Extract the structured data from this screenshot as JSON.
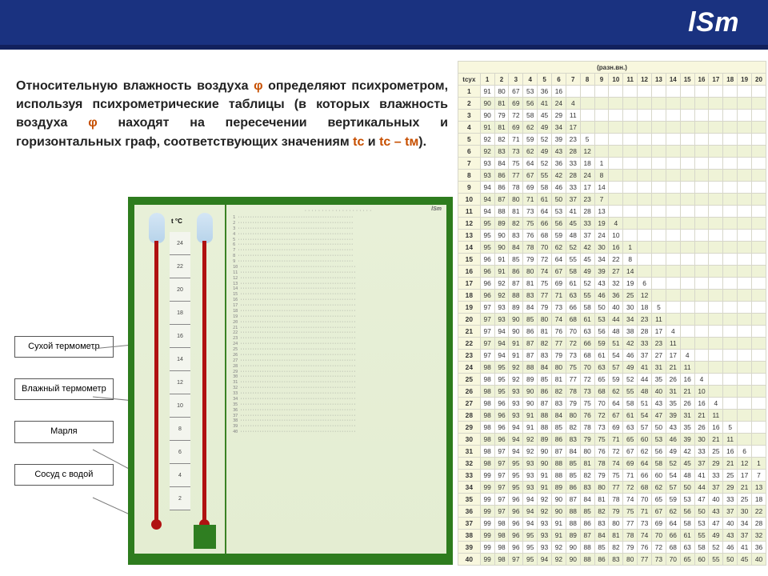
{
  "brand": "lSm",
  "desc": {
    "a": "Относительную влажность воздуха ",
    "phi": "φ",
    "b": " определяют психрометром, используя психрометрические таблицы (в которых влажность воздуха ",
    "c": " находят на пересечении вертикальных и горизонтальных граф, соответствующих значениям ",
    "tc": "tс",
    "and": " и ",
    "diff": "tс – tм",
    "end": ")."
  },
  "labels": {
    "dry": "Сухой термометр",
    "wet": "Влажный термометр",
    "gauze": "Марля",
    "vessel": "Сосуд с водой"
  },
  "scale": {
    "title": "t °C",
    "ticks": [
      "24",
      "22",
      "20",
      "18",
      "16",
      "14",
      "12",
      "10",
      "8",
      "6",
      "4",
      "2"
    ]
  },
  "table": {
    "unit_header": "(разн.вн.)",
    "lead": "tсух",
    "cols": [
      "1",
      "2",
      "3",
      "4",
      "5",
      "6",
      "7",
      "8",
      "9",
      "10",
      "11",
      "12",
      "13",
      "14",
      "15",
      "16",
      "17",
      "18",
      "19",
      "20"
    ],
    "rows": [
      {
        "t": "1",
        "v": [
          "91",
          "80",
          "67",
          "53",
          "36",
          "16",
          "",
          "",
          "",
          "",
          "",
          "",
          "",
          "",
          "",
          "",
          "",
          "",
          "",
          ""
        ]
      },
      {
        "t": "2",
        "v": [
          "90",
          "81",
          "69",
          "56",
          "41",
          "24",
          "4",
          "",
          "",
          "",
          "",
          "",
          "",
          "",
          "",
          "",
          "",
          "",
          "",
          ""
        ]
      },
      {
        "t": "3",
        "v": [
          "90",
          "79",
          "72",
          "58",
          "45",
          "29",
          "11",
          "",
          "",
          "",
          "",
          "",
          "",
          "",
          "",
          "",
          "",
          "",
          "",
          ""
        ]
      },
      {
        "t": "4",
        "v": [
          "91",
          "81",
          "69",
          "62",
          "49",
          "34",
          "17",
          "",
          "",
          "",
          "",
          "",
          "",
          "",
          "",
          "",
          "",
          "",
          "",
          ""
        ]
      },
      {
        "t": "5",
        "v": [
          "92",
          "82",
          "71",
          "59",
          "52",
          "39",
          "23",
          "5",
          "",
          "",
          "",
          "",
          "",
          "",
          "",
          "",
          "",
          "",
          "",
          ""
        ]
      },
      {
        "t": "6",
        "v": [
          "92",
          "83",
          "73",
          "62",
          "49",
          "43",
          "28",
          "12",
          "",
          "",
          "",
          "",
          "",
          "",
          "",
          "",
          "",
          "",
          "",
          ""
        ]
      },
      {
        "t": "7",
        "v": [
          "93",
          "84",
          "75",
          "64",
          "52",
          "36",
          "33",
          "18",
          "1",
          "",
          "",
          "",
          "",
          "",
          "",
          "",
          "",
          "",
          "",
          ""
        ]
      },
      {
        "t": "8",
        "v": [
          "93",
          "86",
          "77",
          "67",
          "55",
          "42",
          "28",
          "24",
          "8",
          "",
          "",
          "",
          "",
          "",
          "",
          "",
          "",
          "",
          "",
          ""
        ]
      },
      {
        "t": "9",
        "v": [
          "94",
          "86",
          "78",
          "69",
          "58",
          "46",
          "33",
          "17",
          "14",
          "",
          "",
          "",
          "",
          "",
          "",
          "",
          "",
          "",
          "",
          ""
        ]
      },
      {
        "t": "10",
        "v": [
          "94",
          "87",
          "80",
          "71",
          "61",
          "50",
          "37",
          "23",
          "7",
          "",
          "",
          "",
          "",
          "",
          "",
          "",
          "",
          "",
          "",
          ""
        ]
      },
      {
        "t": "11",
        "v": [
          "94",
          "88",
          "81",
          "73",
          "64",
          "53",
          "41",
          "28",
          "13",
          "",
          "",
          "",
          "",
          "",
          "",
          "",
          "",
          "",
          "",
          ""
        ]
      },
      {
        "t": "12",
        "v": [
          "95",
          "89",
          "82",
          "75",
          "66",
          "56",
          "45",
          "33",
          "19",
          "4",
          "",
          "",
          "",
          "",
          "",
          "",
          "",
          "",
          "",
          ""
        ]
      },
      {
        "t": "13",
        "v": [
          "95",
          "90",
          "83",
          "76",
          "68",
          "59",
          "48",
          "37",
          "24",
          "10",
          "",
          "",
          "",
          "",
          "",
          "",
          "",
          "",
          "",
          ""
        ]
      },
      {
        "t": "14",
        "v": [
          "95",
          "90",
          "84",
          "78",
          "70",
          "62",
          "52",
          "42",
          "30",
          "16",
          "1",
          "",
          "",
          "",
          "",
          "",
          "",
          "",
          "",
          ""
        ]
      },
      {
        "t": "15",
        "v": [
          "96",
          "91",
          "85",
          "79",
          "72",
          "64",
          "55",
          "45",
          "34",
          "22",
          "8",
          "",
          "",
          "",
          "",
          "",
          "",
          "",
          "",
          ""
        ]
      },
      {
        "t": "16",
        "v": [
          "96",
          "91",
          "86",
          "80",
          "74",
          "67",
          "58",
          "49",
          "39",
          "27",
          "14",
          "",
          "",
          "",
          "",
          "",
          "",
          "",
          "",
          ""
        ]
      },
      {
        "t": "17",
        "v": [
          "96",
          "92",
          "87",
          "81",
          "75",
          "69",
          "61",
          "52",
          "43",
          "32",
          "19",
          "6",
          "",
          "",
          "",
          "",
          "",
          "",
          "",
          ""
        ]
      },
      {
        "t": "18",
        "v": [
          "96",
          "92",
          "88",
          "83",
          "77",
          "71",
          "63",
          "55",
          "46",
          "36",
          "25",
          "12",
          "",
          "",
          "",
          "",
          "",
          "",
          "",
          ""
        ]
      },
      {
        "t": "19",
        "v": [
          "97",
          "93",
          "89",
          "84",
          "79",
          "73",
          "66",
          "58",
          "50",
          "40",
          "30",
          "18",
          "5",
          "",
          "",
          "",
          "",
          "",
          "",
          ""
        ]
      },
      {
        "t": "20",
        "v": [
          "97",
          "93",
          "90",
          "85",
          "80",
          "74",
          "68",
          "61",
          "53",
          "44",
          "34",
          "23",
          "11",
          "",
          "",
          "",
          "",
          "",
          "",
          ""
        ]
      },
      {
        "t": "21",
        "v": [
          "97",
          "94",
          "90",
          "86",
          "81",
          "76",
          "70",
          "63",
          "56",
          "48",
          "38",
          "28",
          "17",
          "4",
          "",
          "",
          "",
          "",
          "",
          ""
        ]
      },
      {
        "t": "22",
        "v": [
          "97",
          "94",
          "91",
          "87",
          "82",
          "77",
          "72",
          "66",
          "59",
          "51",
          "42",
          "33",
          "23",
          "11",
          "",
          "",
          "",
          "",
          "",
          ""
        ]
      },
      {
        "t": "23",
        "v": [
          "97",
          "94",
          "91",
          "87",
          "83",
          "79",
          "73",
          "68",
          "61",
          "54",
          "46",
          "37",
          "27",
          "17",
          "4",
          "",
          "",
          "",
          "",
          ""
        ]
      },
      {
        "t": "24",
        "v": [
          "98",
          "95",
          "92",
          "88",
          "84",
          "80",
          "75",
          "70",
          "63",
          "57",
          "49",
          "41",
          "31",
          "21",
          "11",
          "",
          "",
          "",
          "",
          ""
        ]
      },
      {
        "t": "25",
        "v": [
          "98",
          "95",
          "92",
          "89",
          "85",
          "81",
          "77",
          "72",
          "65",
          "59",
          "52",
          "44",
          "35",
          "26",
          "16",
          "4",
          "",
          "",
          "",
          ""
        ]
      },
      {
        "t": "26",
        "v": [
          "98",
          "95",
          "93",
          "90",
          "86",
          "82",
          "78",
          "73",
          "68",
          "62",
          "55",
          "48",
          "40",
          "31",
          "21",
          "10",
          "",
          "",
          "",
          ""
        ]
      },
      {
        "t": "27",
        "v": [
          "98",
          "96",
          "93",
          "90",
          "87",
          "83",
          "79",
          "75",
          "70",
          "64",
          "58",
          "51",
          "43",
          "35",
          "26",
          "16",
          "4",
          "",
          "",
          ""
        ]
      },
      {
        "t": "28",
        "v": [
          "98",
          "96",
          "93",
          "91",
          "88",
          "84",
          "80",
          "76",
          "72",
          "67",
          "61",
          "54",
          "47",
          "39",
          "31",
          "21",
          "11",
          "",
          "",
          ""
        ]
      },
      {
        "t": "29",
        "v": [
          "98",
          "96",
          "94",
          "91",
          "88",
          "85",
          "82",
          "78",
          "73",
          "69",
          "63",
          "57",
          "50",
          "43",
          "35",
          "26",
          "16",
          "5",
          "",
          ""
        ]
      },
      {
        "t": "30",
        "v": [
          "98",
          "96",
          "94",
          "92",
          "89",
          "86",
          "83",
          "79",
          "75",
          "71",
          "65",
          "60",
          "53",
          "46",
          "39",
          "30",
          "21",
          "11",
          "",
          ""
        ]
      },
      {
        "t": "31",
        "v": [
          "98",
          "97",
          "94",
          "92",
          "90",
          "87",
          "84",
          "80",
          "76",
          "72",
          "67",
          "62",
          "56",
          "49",
          "42",
          "33",
          "25",
          "16",
          "6",
          ""
        ]
      },
      {
        "t": "32",
        "v": [
          "98",
          "97",
          "95",
          "93",
          "90",
          "88",
          "85",
          "81",
          "78",
          "74",
          "69",
          "64",
          "58",
          "52",
          "45",
          "37",
          "29",
          "21",
          "12",
          "1"
        ]
      },
      {
        "t": "33",
        "v": [
          "99",
          "97",
          "95",
          "93",
          "91",
          "88",
          "85",
          "82",
          "79",
          "75",
          "71",
          "66",
          "60",
          "54",
          "48",
          "41",
          "33",
          "25",
          "17",
          "7"
        ]
      },
      {
        "t": "34",
        "v": [
          "99",
          "97",
          "95",
          "93",
          "91",
          "89",
          "86",
          "83",
          "80",
          "77",
          "72",
          "68",
          "62",
          "57",
          "50",
          "44",
          "37",
          "29",
          "21",
          "13"
        ]
      },
      {
        "t": "35",
        "v": [
          "99",
          "97",
          "96",
          "94",
          "92",
          "90",
          "87",
          "84",
          "81",
          "78",
          "74",
          "70",
          "65",
          "59",
          "53",
          "47",
          "40",
          "33",
          "25",
          "18"
        ]
      },
      {
        "t": "36",
        "v": [
          "99",
          "97",
          "96",
          "94",
          "92",
          "90",
          "88",
          "85",
          "82",
          "79",
          "75",
          "71",
          "67",
          "62",
          "56",
          "50",
          "43",
          "37",
          "30",
          "22"
        ]
      },
      {
        "t": "37",
        "v": [
          "99",
          "98",
          "96",
          "94",
          "93",
          "91",
          "88",
          "86",
          "83",
          "80",
          "77",
          "73",
          "69",
          "64",
          "58",
          "53",
          "47",
          "40",
          "34",
          "28"
        ]
      },
      {
        "t": "38",
        "v": [
          "99",
          "98",
          "96",
          "95",
          "93",
          "91",
          "89",
          "87",
          "84",
          "81",
          "78",
          "74",
          "70",
          "66",
          "61",
          "55",
          "49",
          "43",
          "37",
          "32"
        ]
      },
      {
        "t": "39",
        "v": [
          "99",
          "98",
          "96",
          "95",
          "93",
          "92",
          "90",
          "88",
          "85",
          "82",
          "79",
          "76",
          "72",
          "68",
          "63",
          "58",
          "52",
          "46",
          "41",
          "36"
        ]
      },
      {
        "t": "40",
        "v": [
          "99",
          "98",
          "97",
          "95",
          "94",
          "92",
          "90",
          "88",
          "86",
          "83",
          "80",
          "77",
          "73",
          "70",
          "65",
          "60",
          "55",
          "50",
          "45",
          "40"
        ]
      }
    ]
  }
}
